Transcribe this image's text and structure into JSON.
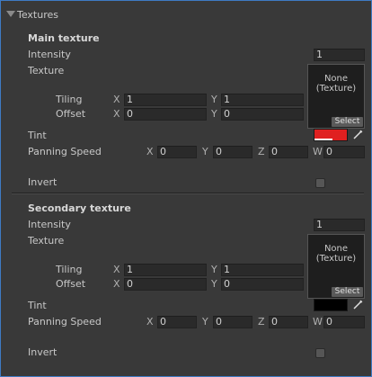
{
  "header": {
    "title": "Textures"
  },
  "main": {
    "title": "Main texture",
    "intensity_label": "Intensity",
    "intensity_value": "1",
    "texture_label": "Texture",
    "texture_box": {
      "line1": "None",
      "line2": "(Texture)",
      "select": "Select"
    },
    "tiling_label": "Tiling",
    "tiling_x": "1",
    "tiling_y": "1",
    "offset_label": "Offset",
    "offset_x": "0",
    "offset_y": "0",
    "tint_label": "Tint",
    "tint_color": "#e02020",
    "tint_alpha": 0.55,
    "panning_label": "Panning Speed",
    "pan_x": "0",
    "pan_y": "0",
    "pan_z": "0",
    "pan_w": "0",
    "invert_label": "Invert",
    "invert_checked": false
  },
  "secondary": {
    "title": "Secondary texture",
    "intensity_label": "Intensity",
    "intensity_value": "1",
    "texture_label": "Texture",
    "texture_box": {
      "line1": "None",
      "line2": "(Texture)",
      "select": "Select"
    },
    "tiling_label": "Tiling",
    "tiling_x": "1",
    "tiling_y": "1",
    "offset_label": "Offset",
    "offset_x": "0",
    "offset_y": "0",
    "tint_label": "Tint",
    "tint_color": "#000000",
    "panning_label": "Panning Speed",
    "pan_x": "0",
    "pan_y": "0",
    "pan_z": "0",
    "pan_w": "0",
    "invert_label": "Invert",
    "invert_checked": false
  },
  "axes": {
    "x": "X",
    "y": "Y",
    "z": "Z",
    "w": "W"
  },
  "icons": {
    "foldout": "triangle-down-icon",
    "picker": "eyedropper-icon"
  }
}
